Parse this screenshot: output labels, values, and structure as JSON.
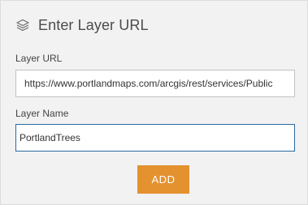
{
  "header": {
    "icon": "layers-icon",
    "title": "Enter Layer URL"
  },
  "layer_url": {
    "label": "Layer URL",
    "value": "https://www.portlandmaps.com/arcgis/rest/services/Public"
  },
  "layer_name": {
    "label": "Layer Name",
    "value": "PortlandTrees"
  },
  "actions": {
    "add_label": "ADD"
  },
  "colors": {
    "accent": "#e4912f",
    "panel_background": "#f2f2f2",
    "focus_border": "#2b6aa0"
  }
}
